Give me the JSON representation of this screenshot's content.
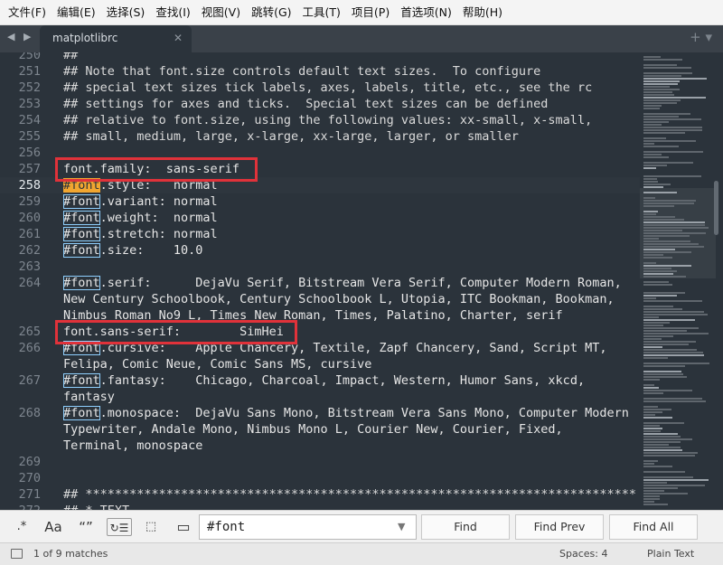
{
  "menu": [
    "文件(F)",
    "编辑(E)",
    "选择(S)",
    "查找(I)",
    "视图(V)",
    "跳转(G)",
    "工具(T)",
    "项目(P)",
    "首选项(N)",
    "帮助(H)"
  ],
  "tab": {
    "nav": "◀ ▶",
    "title": "matplotlibrc",
    "close": "✕",
    "actions": "+ ▾"
  },
  "editor": {
    "current_line": 258,
    "lines": [
      {
        "no": "250",
        "text": "##"
      },
      {
        "no": "251",
        "text": "## Note that font.size controls default text sizes.  To configure"
      },
      {
        "no": "252",
        "text": "## special text sizes tick labels, axes, labels, title, etc., see the rc"
      },
      {
        "no": "253",
        "text": "## settings for axes and ticks.  Special text sizes can be defined"
      },
      {
        "no": "254",
        "text": "## relative to font.size, using the following values: xx-small, x-small,"
      },
      {
        "no": "255",
        "text": "## small, medium, large, x-large, xx-large, larger, or smaller"
      },
      {
        "no": "256",
        "text": ""
      },
      {
        "no": "257",
        "text": "font.family:  sans-serif"
      },
      {
        "no": "258",
        "pre": "#font",
        "text": ".style:   normal"
      },
      {
        "no": "259",
        "pre": "#font",
        "text": ".variant: normal"
      },
      {
        "no": "260",
        "pre": "#font",
        "text": ".weight:  normal"
      },
      {
        "no": "261",
        "pre": "#font",
        "text": ".stretch: normal"
      },
      {
        "no": "262",
        "pre": "#font",
        "text": ".size:    10.0"
      },
      {
        "no": "263",
        "text": ""
      },
      {
        "no": "264",
        "pre": "#font",
        "text": ".serif:      DejaVu Serif, Bitstream Vera Serif, Computer Modern Roman,"
      },
      {
        "no": "",
        "text": "New Century Schoolbook, Century Schoolbook L, Utopia, ITC Bookman, Bookman,"
      },
      {
        "no": "",
        "text": "Nimbus Roman No9 L, Times New Roman, Times, Palatino, Charter, serif"
      },
      {
        "no": "265",
        "text": "font.sans-serif:        SimHei"
      },
      {
        "no": "266",
        "pre": "#font",
        "text": ".cursive:    Apple Chancery, Textile, Zapf Chancery, Sand, Script MT,"
      },
      {
        "no": "",
        "text": "Felipa, Comic Neue, Comic Sans MS, cursive"
      },
      {
        "no": "267",
        "pre": "#font",
        "text": ".fantasy:    Chicago, Charcoal, Impact, Western, Humor Sans, xkcd,"
      },
      {
        "no": "",
        "text": "fantasy"
      },
      {
        "no": "268",
        "pre": "#font",
        "text": ".monospace:  DejaVu Sans Mono, Bitstream Vera Sans Mono, Computer Modern"
      },
      {
        "no": "",
        "text": "Typewriter, Andale Mono, Nimbus Mono L, Courier New, Courier, Fixed,"
      },
      {
        "no": "",
        "text": "Terminal, monospace"
      },
      {
        "no": "269",
        "text": ""
      },
      {
        "no": "270",
        "text": ""
      },
      {
        "no": "271",
        "text": "## ***************************************************************************"
      },
      {
        "no": "272",
        "text": "## * TEXT"
      }
    ]
  },
  "find": {
    "options": [
      ".*",
      "Aa",
      "“”",
      "↻☰",
      "⬚",
      "▭"
    ],
    "query": "#font",
    "buttons": {
      "find": "Find",
      "find_prev": "Find Prev",
      "find_all": "Find All"
    }
  },
  "status": {
    "matches": "1 of 9 matches",
    "spaces": "Spaces: 4",
    "syntax": "Plain Text"
  },
  "colors": {
    "highlight_box": "#e0323a",
    "active_match": "#f1a630",
    "editor_bg": "#2b333b"
  }
}
